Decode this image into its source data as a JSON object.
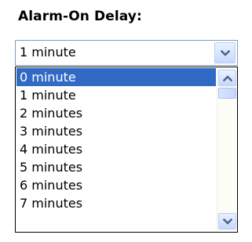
{
  "label": "Alarm-On Delay:",
  "combo": {
    "selected_value": "1 minute"
  },
  "dropdown": {
    "options": [
      {
        "label": "0 minute",
        "highlighted": true
      },
      {
        "label": "1 minute",
        "highlighted": false
      },
      {
        "label": "2 minutes",
        "highlighted": false
      },
      {
        "label": "3 minutes",
        "highlighted": false
      },
      {
        "label": "4 minutes",
        "highlighted": false
      },
      {
        "label": "5 minutes",
        "highlighted": false
      },
      {
        "label": "6 minutes",
        "highlighted": false
      },
      {
        "label": "7 minutes",
        "highlighted": false
      }
    ]
  },
  "icons": {
    "combo_button": "chevron-down-icon",
    "scroll_up": "chevron-up-icon",
    "scroll_down": "chevron-down-icon"
  },
  "colors": {
    "highlight": "#316ac5",
    "arrow": "#4d6185",
    "border": "#7f9db9"
  }
}
